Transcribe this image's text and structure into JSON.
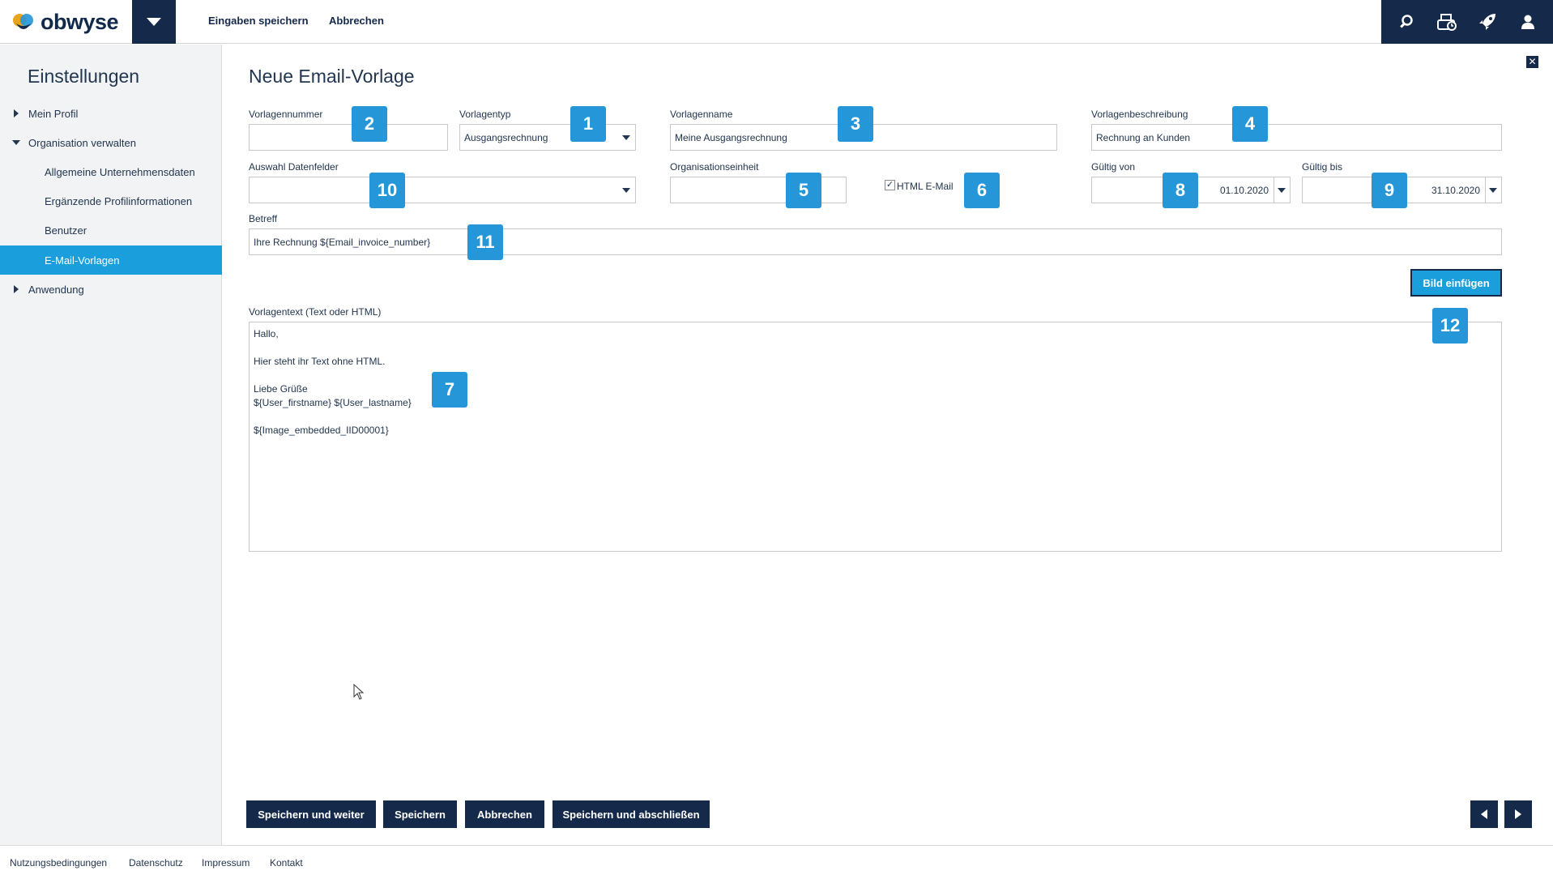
{
  "header": {
    "logo_text": "obwyse",
    "links": {
      "save": "Eingaben speichern",
      "cancel": "Abbrechen"
    }
  },
  "header_icons": [
    "search-icon",
    "cash-register-icon",
    "rocket-icon",
    "user-icon"
  ],
  "sidebar": {
    "title": "Einstellungen",
    "items": [
      {
        "label": "Mein Profil"
      },
      {
        "label": "Organisation verwalten"
      },
      {
        "label": "Allgemeine Unternehmensdaten"
      },
      {
        "label": "Ergänzende Profilinformationen"
      },
      {
        "label": "Benutzer"
      },
      {
        "label": "E-Mail-Vorlagen"
      },
      {
        "label": "Anwendung"
      }
    ]
  },
  "main": {
    "title": "Neue Email-Vorlage",
    "fields": {
      "vorlagennummer": {
        "label": "Vorlagennummer",
        "value": ""
      },
      "vorlagentyp": {
        "label": "Vorlagentyp",
        "value": "Ausgangsrechnung"
      },
      "vorlagenname": {
        "label": "Vorlagenname",
        "value": "Meine Ausgangsrechnung"
      },
      "vorlagenbeschreibung": {
        "label": "Vorlagenbeschreibung",
        "value": "Rechnung an Kunden"
      },
      "datenfelder": {
        "label": "Auswahl Datenfelder",
        "value": ""
      },
      "organisationseinheit": {
        "label": "Organisationseinheit",
        "value": ""
      },
      "html_email": {
        "label": "HTML E-Mail",
        "checked": "✓"
      },
      "gueltig_von": {
        "label": "Gültig von",
        "value": "01.10.2020"
      },
      "gueltig_bis": {
        "label": "Gültig bis",
        "value": "31.10.2020"
      },
      "betreff": {
        "label": "Betreff",
        "value": "Ihre Rechnung ${Email_invoice_number}"
      }
    },
    "insert_image_button": "Bild einfügen",
    "body_label": "Vorlagentext (Text oder HTML)",
    "body_text": "Hallo,\n\nHier steht ihr Text ohne HTML.\n\nLiebe Grüße\n${User_firstname} ${User_lastname}\n\n${Image_embedded_IID00001}",
    "badges": [
      "2",
      "1",
      "3",
      "4",
      "10",
      "5",
      "6",
      "8",
      "9",
      "11",
      "12",
      "7"
    ]
  },
  "actions": {
    "save_continue": "Speichern und weiter",
    "save": "Speichern",
    "cancel": "Abbrechen",
    "save_close": "Speichern und abschließen"
  },
  "footer": {
    "links": [
      "Nutzungsbedingungen",
      "Datenschutz",
      "Impressum",
      "Kontakt"
    ]
  },
  "colors": {
    "navy": "#15294a",
    "accent": "#1a9fdc",
    "badge": "#2596d8"
  }
}
